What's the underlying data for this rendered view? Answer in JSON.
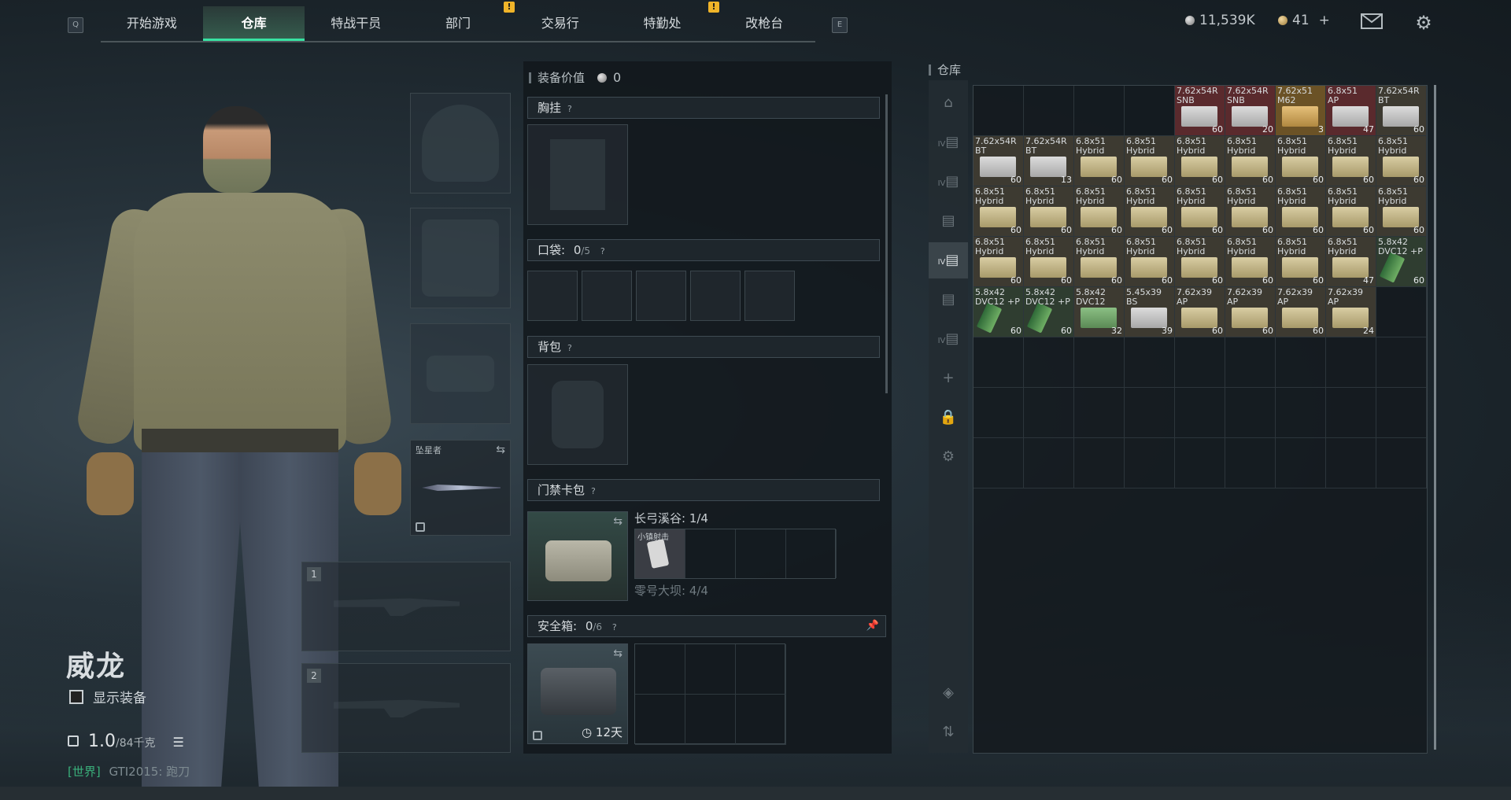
{
  "nav": {
    "key_left": "Q",
    "key_right": "E",
    "tabs": [
      "开始游戏",
      "仓库",
      "特战干员",
      "部门",
      "交易行",
      "特勤处",
      "改枪台"
    ],
    "active_index": 1,
    "alerts": [
      "!",
      "!"
    ]
  },
  "currency": {
    "silver": "11,539K",
    "gold": "41",
    "plus": "+"
  },
  "icons": {
    "mail": "mail-icon",
    "settings": "gear-icon"
  },
  "operator": {
    "name": "威龙",
    "show_equipment": "显示装备",
    "weight_value": "1.0",
    "weight_max": "/84千克",
    "world_tag": "[世界]",
    "world_user": "GTI2015: 跑刀"
  },
  "knife": {
    "label": "坠星者"
  },
  "weapons": {
    "slot1": "1",
    "slot2": "2"
  },
  "equipment": {
    "header": "装备价值",
    "value": "0",
    "chest": "胸挂",
    "pockets": "口袋:",
    "pockets_val": "0",
    "pockets_max": "/5",
    "backpack": "背包",
    "keycard": "门禁卡包",
    "keycard_map1": "长弓溪谷: 1/4",
    "keycard_map2": "零号大坝: 4/4",
    "keycard_item": "小镇射击",
    "safe": "安全箱:",
    "safe_val": "0",
    "safe_max": "/6",
    "safe_days": "12天",
    "q": "?"
  },
  "warehouse": {
    "title": "仓库",
    "side_labels": [
      "IV",
      "IV",
      "IV",
      "IV",
      "IV"
    ],
    "items": [
      {
        "t": "",
        "c": "",
        "k": ""
      },
      {
        "t": "",
        "c": "",
        "k": ""
      },
      {
        "t": "",
        "c": "",
        "k": ""
      },
      {
        "t": "",
        "c": "",
        "k": ""
      },
      {
        "t": "7.62x54R\nSNB",
        "c": "60",
        "k": "red white"
      },
      {
        "t": "7.62x54R\nSNB",
        "c": "20",
        "k": "red white"
      },
      {
        "t": "7.62x51\nM62",
        "c": "3",
        "k": "gold gold"
      },
      {
        "t": "6.8x51\nAP",
        "c": "47",
        "k": "red white"
      },
      {
        "t": "7.62x54R\nBT",
        "c": "60",
        "k": "i white"
      },
      {
        "t": "7.62x54R\nBT",
        "c": "60",
        "k": "i white"
      },
      {
        "t": "7.62x54R\nBT",
        "c": "13",
        "k": "i white"
      },
      {
        "t": "6.8x51\nHybrid",
        "c": "60",
        "k": "i ammo"
      },
      {
        "t": "6.8x51\nHybrid",
        "c": "60",
        "k": "i ammo"
      },
      {
        "t": "6.8x51\nHybrid",
        "c": "60",
        "k": "i ammo"
      },
      {
        "t": "6.8x51\nHybrid",
        "c": "60",
        "k": "i ammo"
      },
      {
        "t": "6.8x51\nHybrid",
        "c": "60",
        "k": "i ammo"
      },
      {
        "t": "6.8x51\nHybrid",
        "c": "60",
        "k": "i ammo"
      },
      {
        "t": "6.8x51\nHybrid",
        "c": "60",
        "k": "i ammo"
      },
      {
        "t": "6.8x51\nHybrid",
        "c": "60",
        "k": "i ammo"
      },
      {
        "t": "6.8x51\nHybrid",
        "c": "60",
        "k": "i ammo"
      },
      {
        "t": "6.8x51\nHybrid",
        "c": "60",
        "k": "i ammo"
      },
      {
        "t": "6.8x51\nHybrid",
        "c": "60",
        "k": "i ammo"
      },
      {
        "t": "6.8x51\nHybrid",
        "c": "60",
        "k": "i ammo"
      },
      {
        "t": "6.8x51\nHybrid",
        "c": "60",
        "k": "i ammo"
      },
      {
        "t": "6.8x51\nHybrid",
        "c": "60",
        "k": "i ammo"
      },
      {
        "t": "6.8x51\nHybrid",
        "c": "60",
        "k": "i ammo"
      },
      {
        "t": "6.8x51\nHybrid",
        "c": "60",
        "k": "i ammo"
      },
      {
        "t": "6.8x51\nHybrid",
        "c": "60",
        "k": "i ammo"
      },
      {
        "t": "6.8x51\nHybrid",
        "c": "60",
        "k": "i ammo"
      },
      {
        "t": "6.8x51\nHybrid",
        "c": "60",
        "k": "i ammo"
      },
      {
        "t": "6.8x51\nHybrid",
        "c": "60",
        "k": "i ammo"
      },
      {
        "t": "6.8x51\nHybrid",
        "c": "60",
        "k": "i ammo"
      },
      {
        "t": "6.8x51\nHybrid",
        "c": "60",
        "k": "i ammo"
      },
      {
        "t": "6.8x51\nHybrid",
        "c": "60",
        "k": "i ammo"
      },
      {
        "t": "6.8x51\nHybrid",
        "c": "47",
        "k": "i ammo"
      },
      {
        "t": "5.8x42\nDVC12 +P",
        "c": "60",
        "k": "green mag"
      },
      {
        "t": "5.8x42\nDVC12 +P",
        "c": "60",
        "k": "green mag"
      },
      {
        "t": "5.8x42\nDVC12 +P",
        "c": "60",
        "k": "green mag"
      },
      {
        "t": "5.8x42\nDVC12",
        "c": "32",
        "k": "i green"
      },
      {
        "t": "5.45x39\nBS",
        "c": "39",
        "k": "i white"
      },
      {
        "t": "7.62x39\nAP",
        "c": "60",
        "k": "i ammo"
      },
      {
        "t": "7.62x39\nAP",
        "c": "60",
        "k": "i ammo"
      },
      {
        "t": "7.62x39\nAP",
        "c": "60",
        "k": "i ammo"
      },
      {
        "t": "7.62x39\nAP",
        "c": "24",
        "k": "i ammo"
      },
      {
        "t": "",
        "c": "",
        "k": ""
      }
    ]
  },
  "colors": {
    "accent": "#38e2a3",
    "alert": "#f0b429"
  }
}
